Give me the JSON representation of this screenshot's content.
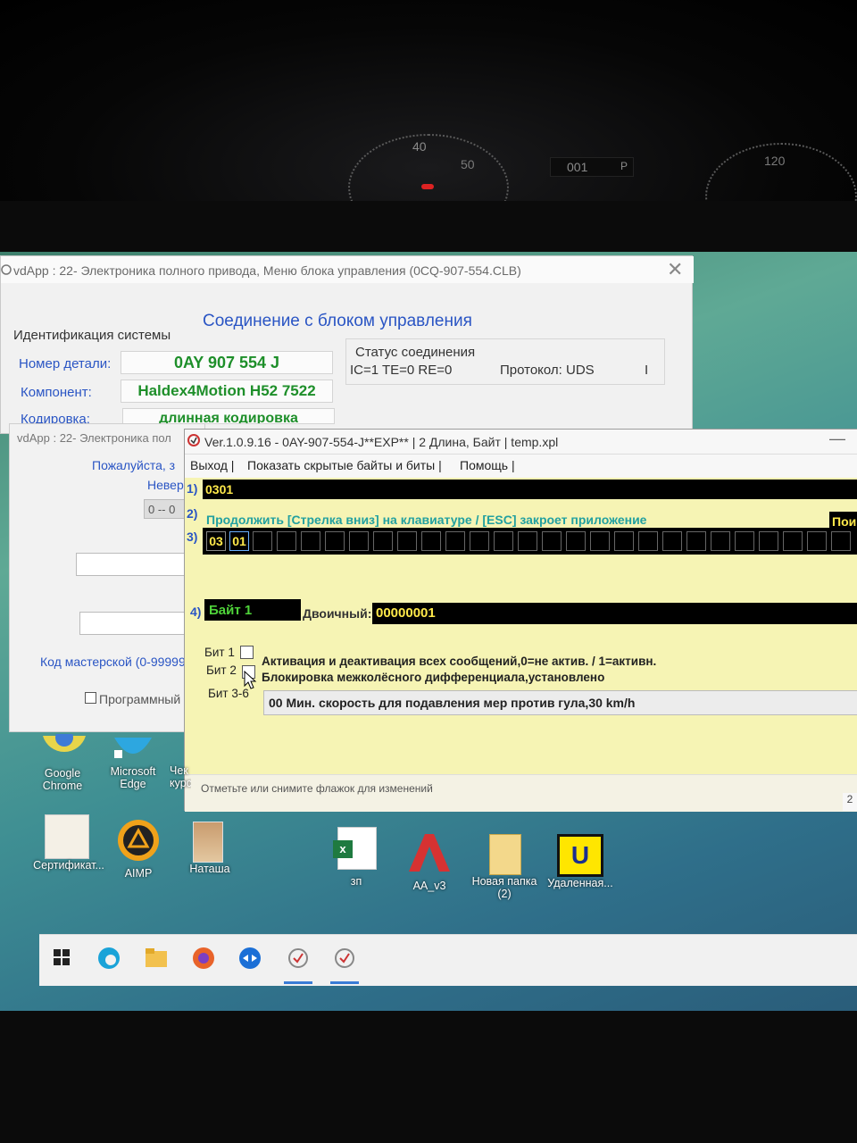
{
  "main_window": {
    "title": "vdApp : 22- Электроника полного привода,  Меню блока управления (0CQ-907-554.CLB)",
    "close_icon": "close-icon",
    "connection_heading": "Соединение с блоком управления",
    "system_id_label": "Идентификация системы",
    "part_number_label": "Номер детали:",
    "part_number_value": "0AY 907 554 J",
    "component_label": "Компонент:",
    "component_value": "Haldex4Motion H52 7522",
    "coding_label": "Кодировка:",
    "coding_value": "длинная кодировка",
    "status_title": "Статус соединения",
    "status_values": "IC=1  TE=0  RE=0",
    "protocol": "Протокол: UDS",
    "status_extra": "I"
  },
  "second_window": {
    "title": "vdApp : 22- Электроника пол",
    "please_text": "Пожалуйста, з",
    "invalid_text": "Невер",
    "range_text": "0 -- 0",
    "workshop_label": "Код мастерской (0-99999",
    "program_checkbox_label": "Программный с"
  },
  "editor": {
    "title": "Ver.1.0.9.16 -   0AY-907-554-J**EXP** | 2 Длина, Байт | temp.xpl",
    "menu": {
      "exit": "Выход |",
      "show_hidden": "Показать скрытые байты и биты |",
      "help": "Помощь |"
    },
    "row1_label": "1)",
    "row1_value": "0301",
    "row2_label": "2)",
    "row2_text": "Продолжить [Стрелка вниз] на клавиатуре / [ESC] закроет приложение",
    "row2_button": "Пои",
    "row3_label": "3)",
    "row3_byte1": "03",
    "row3_byte2": "01",
    "row4_label": "4)",
    "byte_label": "Байт 1",
    "binary_label": "Двоичный:",
    "binary_value": "00000001",
    "bit1_label": "Бит 1",
    "bit1_text": "Активация и деактивация всех сообщений,0=не актив. / 1=активн.",
    "bit2_label": "Бит 2",
    "bit2_text": "Блокировка межколёсного дифференциала,установлено",
    "bit36_label": "Бит 3-6",
    "bit36_value": "00 Мин. скорость для подавления мер против гула,30 km/h",
    "status_bar": "Отметьте или снимите флажок для изменений",
    "status_right": "2"
  },
  "desktop": {
    "icons": [
      {
        "label": "Google Chrome",
        "icon": "chrome-icon"
      },
      {
        "label": "Microsoft Edge",
        "icon": "edge-icon"
      },
      {
        "label": "Чек курсов",
        "icon": "shortcut-icon"
      },
      {
        "label": "Сертификат...",
        "icon": "certificate-icon"
      },
      {
        "label": "AIMP",
        "icon": "aimp-icon"
      },
      {
        "label": "Наташа",
        "icon": "photo-icon"
      },
      {
        "label": "зп",
        "icon": "excel-icon"
      },
      {
        "label": "AA_v3",
        "icon": "ammyy-icon"
      },
      {
        "label": "Новая папка (2)",
        "icon": "folder-icon"
      },
      {
        "label": "Удаленная...",
        "icon": "vnc-icon"
      }
    ]
  },
  "taskbar": {
    "items": [
      "windows-start-icon",
      "edge-icon",
      "file-explorer-icon",
      "firefox-icon",
      "teamviewer-icon",
      "vdapp-icon",
      "vdapp-icon"
    ]
  },
  "dashboard": {
    "gauge_left": "40",
    "gauge_mid": "50",
    "odometer": "001",
    "gear": "P",
    "gauge_right": "120"
  }
}
